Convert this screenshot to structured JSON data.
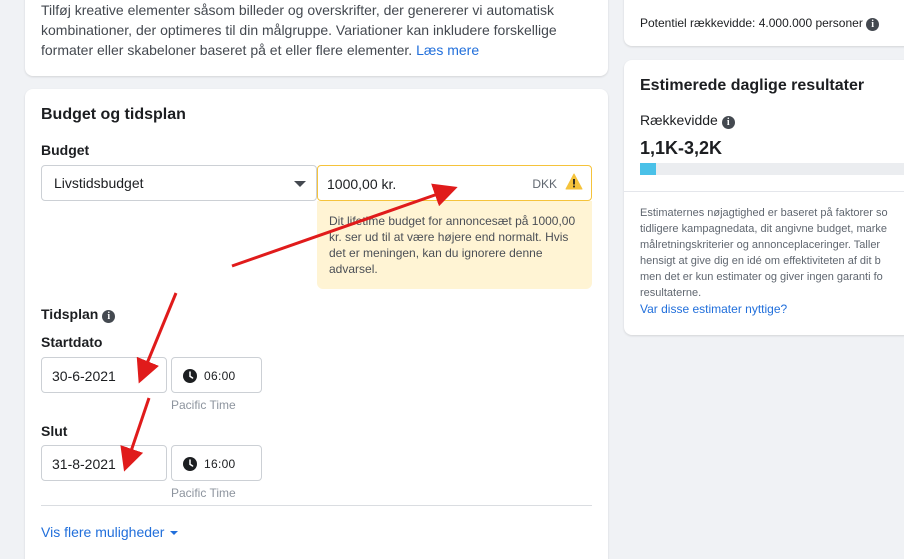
{
  "creative": {
    "description_lines": [
      "Tilføj kreative elementer såsom billeder og overskrifter, der genererer vi automatisk",
      "kombinationer, der optimeres til din målgruppe. Variationer kan inkludere forskellige",
      "formater eller skabeloner baseret på et eller flere elementer."
    ],
    "read_more": "Læs mere"
  },
  "budget": {
    "section_title": "Budget og tidsplan",
    "budget_label": "Budget",
    "budget_type": "Livstidsbudget",
    "amount": "1000,00 kr.",
    "currency": "DKK",
    "warning_lines": [
      "Dit lifetime budget for annoncesæt på 1000,00",
      "kr. ser ud til at være højere end normalt. Hvis",
      "det er meningen, kan du ignorere denne",
      "advarsel."
    ],
    "schedule_label": "Tidsplan",
    "start_label": "Startdato",
    "start_date": "30-6-2021",
    "start_time": "06:00",
    "end_label": "Slut",
    "end_date": "31-8-2021",
    "end_time": "16:00",
    "timezone": "Pacific Time",
    "more_options": "Vis flere muligheder"
  },
  "reach": {
    "potential": "Potentiel rækkevidde: 4.000.000 personer"
  },
  "results": {
    "title": "Estimerede daglige resultater",
    "reach_label": "Rækkevidde",
    "reach_value": "1,1K-3,2K",
    "reach_fill": 0.055,
    "note_lines": [
      "Estimaternes nøjagtighed er baseret på faktorer so",
      "tidligere kampagnedata, dit angivne budget, marke",
      "målretningskriterier og annonceplaceringer. Taller",
      "hensigt at give dig en idé om effektiviteten af dit b",
      "men det er kun estimater og giver ingen garanti fo",
      "resultaterne."
    ],
    "useful_link": "Var disse estimater nyttige?"
  },
  "colors": {
    "accent": "#216fdb",
    "warning_border": "#f5c33b",
    "warning_bg": "#fff4d4",
    "annotation_arrow": "#e01b1b",
    "reach_fill": "#4ac1e8"
  }
}
